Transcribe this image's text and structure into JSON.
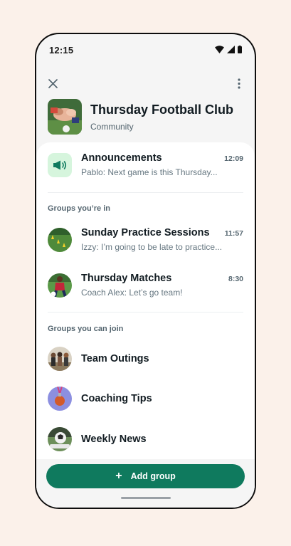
{
  "status_bar": {
    "time": "12:15"
  },
  "community": {
    "title": "Thursday Football Club",
    "subtitle": "Community"
  },
  "announcement": {
    "name": "Announcements",
    "time": "12:09",
    "preview": "Pablo: Next game is this Thursday..."
  },
  "sections": {
    "groups_in": "Groups you’re in",
    "groups_join": "Groups you can join"
  },
  "groups_in": [
    {
      "name": "Sunday Practice Sessions",
      "time": "11:57",
      "preview": "Izzy: I’m going to be late to practice..."
    },
    {
      "name": "Thursday Matches",
      "time": "8:30",
      "preview": "Coach Alex: Let’s go team!"
    }
  ],
  "groups_join": [
    {
      "name": "Team Outings"
    },
    {
      "name": "Coaching Tips"
    },
    {
      "name": "Weekly News"
    }
  ],
  "actions": {
    "add_group": "Add group"
  },
  "colors": {
    "accent": "#0f7a5e",
    "announce_bg": "#d6f5dd"
  }
}
